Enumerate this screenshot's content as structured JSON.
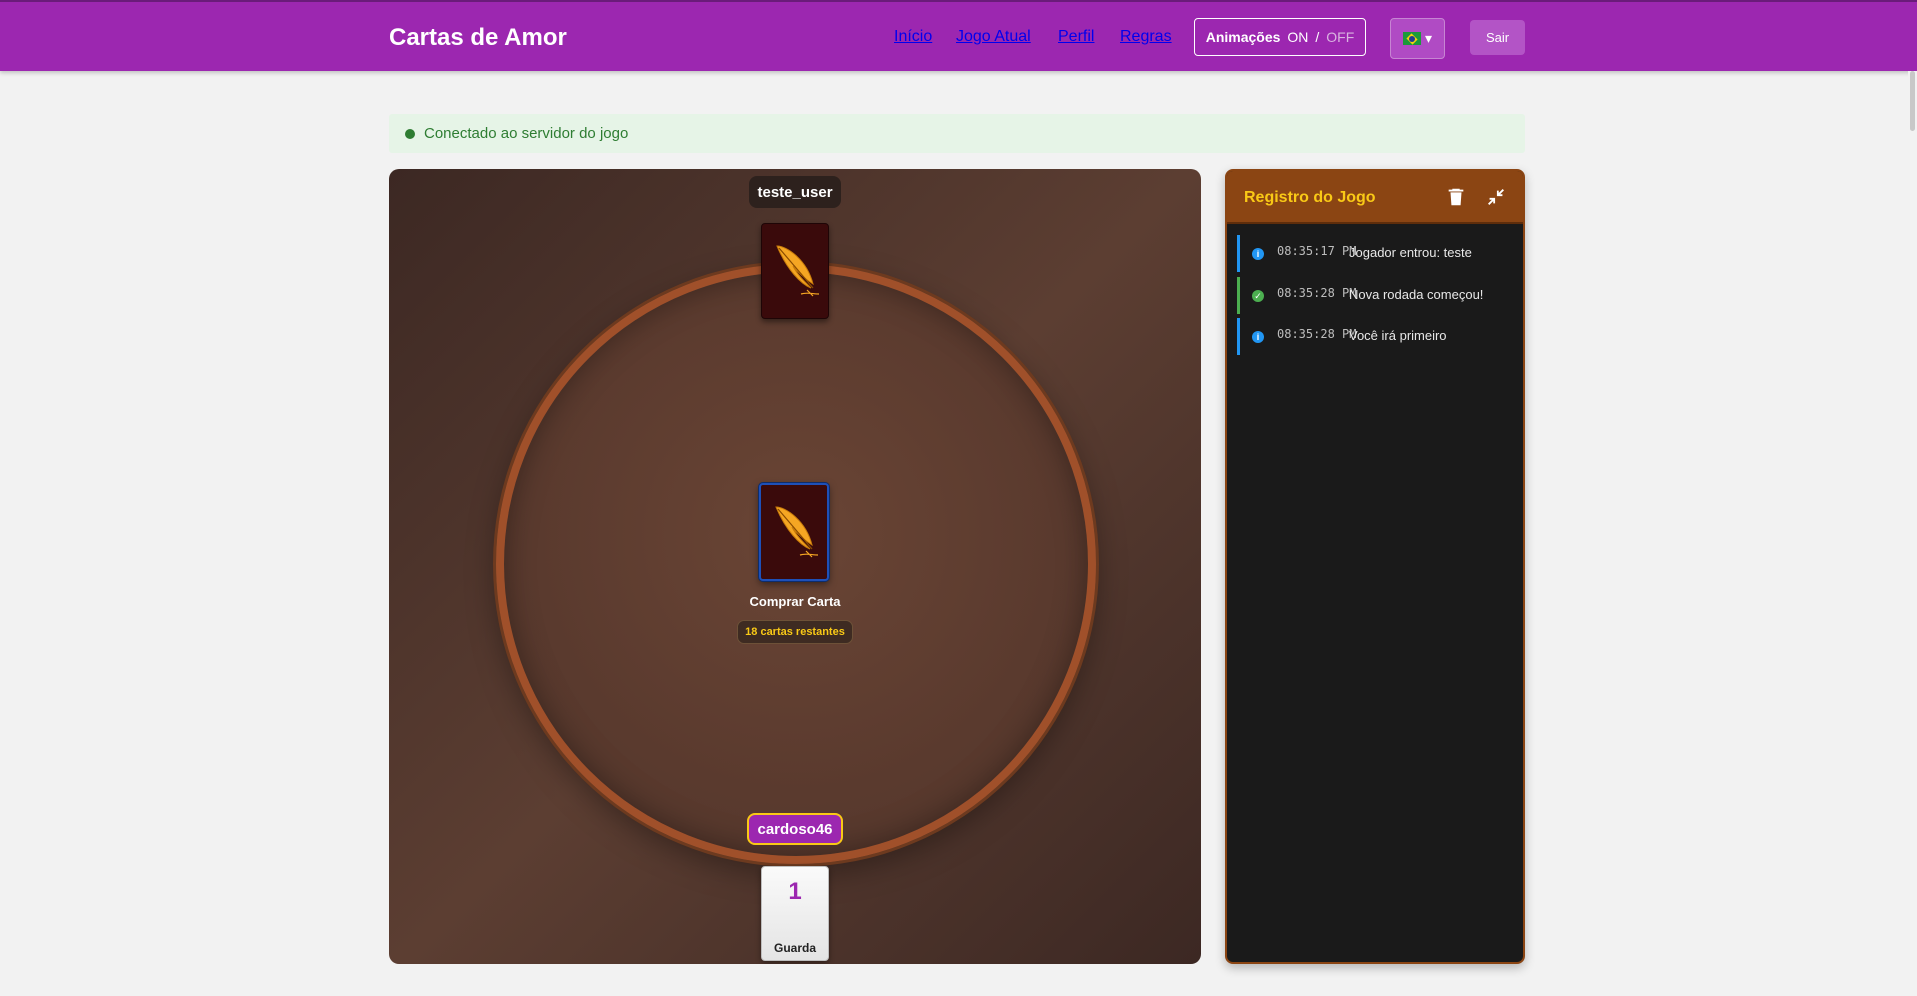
{
  "header": {
    "brand": "Cartas de Amor",
    "nav": [
      {
        "label": "Início"
      },
      {
        "label": "Jogo Atual"
      },
      {
        "label": "Perfil"
      },
      {
        "label": "Regras"
      }
    ],
    "animations": {
      "label": "Animações",
      "on": "ON",
      "separator": "/",
      "off": "OFF"
    },
    "language": {
      "flag": "brazil-flag",
      "caret": "▾"
    },
    "logout_label": "Sair",
    "accent_color": "#9c27b0"
  },
  "connection": {
    "message": "Conectado ao servidor do jogo",
    "color": "#2e7d32"
  },
  "game": {
    "opponent_name": "teste_user",
    "deck_label": "Comprar Carta",
    "deck_remaining": "18 cartas restantes",
    "self_name": "cardoso46",
    "hand_card": {
      "value": "1",
      "name": "Guarda"
    }
  },
  "log": {
    "title": "Registro do Jogo",
    "entries": [
      {
        "time": "08:35:17 PM",
        "message": "Jogador entrou: teste",
        "type": "info"
      },
      {
        "time": "08:35:28 PM",
        "message": "Nova rodada começou!",
        "type": "success"
      },
      {
        "time": "08:35:28 PM",
        "message": "Você irá primeiro",
        "type": "info"
      }
    ]
  }
}
